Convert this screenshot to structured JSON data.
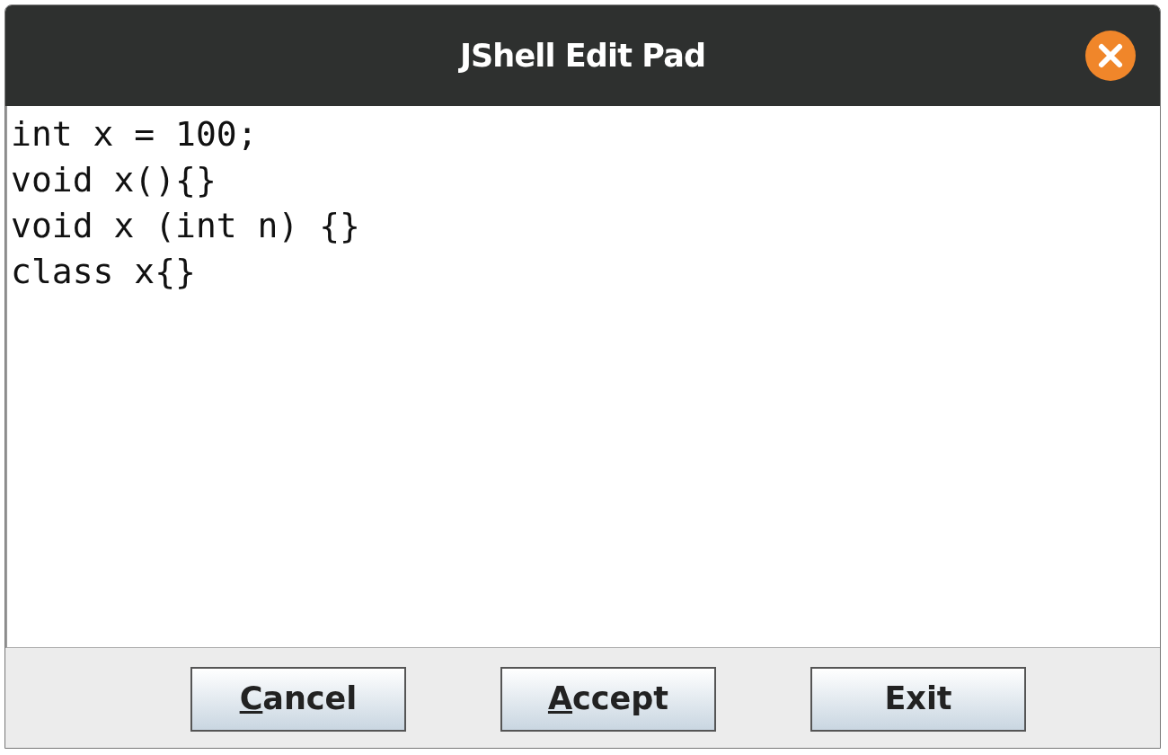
{
  "window": {
    "title": "JShell Edit Pad"
  },
  "editor": {
    "lines": [
      "int x = 100;",
      "void x(){}",
      "void x (int n) {}",
      "class x{}"
    ]
  },
  "buttons": [
    {
      "label": "Cancel",
      "first_letter_underlined": true
    },
    {
      "label": "Accept",
      "first_letter_underlined": true
    },
    {
      "label": "Exit",
      "first_letter_underlined": false
    }
  ]
}
